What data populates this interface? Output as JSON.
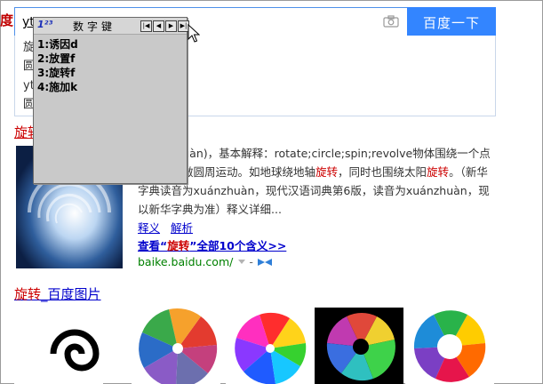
{
  "edge_glyph": "度",
  "search": {
    "value": "yt",
    "button_label": "百度一下"
  },
  "suggestions": [
    "旋",
    "圆",
    "yt",
    "圆"
  ],
  "ime": {
    "logo": "1²³",
    "name": "数字键",
    "nav": [
      "|◀",
      "◀",
      "▶",
      "▶|"
    ],
    "items": [
      "1:诱因d",
      "2:放置f",
      "3:旋转f",
      "4:施加k"
    ]
  },
  "result": {
    "title": "旋转",
    "abstract_1": "(xuánzhuàn)，基本解释：rotate;circle;spin;revolve物体围绕一个点或一个轴做圆周运动。如地球绕地轴",
    "abstract_red_1": "旋转",
    "abstract_2": "，同时也围绕太阳",
    "abstract_red_2": "旋转",
    "abstract_3": "。（新华字典读音为xuánzhuàn，现代汉语词典第6版，读音为xuánzhuàn，现以新华字典为准）释义详细...",
    "link_1": "释义",
    "link_2": "解析",
    "see_all_prefix": "查看“",
    "see_all_red": "旋转",
    "see_all_suffix": "”全部10个含义>>",
    "site": "baike.baidu.com/",
    "site_dash": "-"
  },
  "images_section": {
    "title_red": "旋转",
    "title_rest": "_百度图片"
  },
  "colors": {
    "search_blue": "#3385ff",
    "link_blue": "#0000cc",
    "highlight_red": "#cc0000",
    "url_green": "#008000",
    "ime_gray": "#c9c9c9"
  }
}
